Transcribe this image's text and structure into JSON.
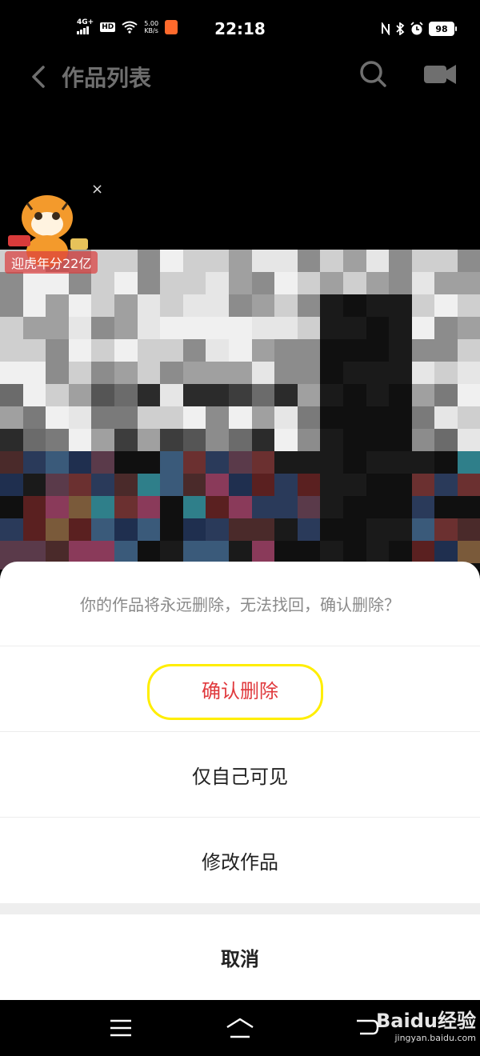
{
  "status_bar": {
    "network": "4G+",
    "hd": "HD",
    "speed_top": "5.00",
    "speed_bottom": "KB/s",
    "time": "22:18",
    "battery": "98"
  },
  "header": {
    "title": "作品列表",
    "icons": [
      "back-icon",
      "search-icon",
      "camera-icon"
    ]
  },
  "promo": {
    "banner_text": "迎虎年分22亿",
    "close_label": "×"
  },
  "sheet": {
    "message": "你的作品将永远删除，无法找回，确认删除？",
    "confirm_delete": "确认删除",
    "private_only": "仅自己可见",
    "edit_work": "修改作品",
    "cancel": "取消",
    "colors": {
      "danger": "#e0393d",
      "highlight": "#ffee00"
    }
  },
  "nav_bar": {
    "icons": [
      "menu-icon",
      "home-icon",
      "back-icon"
    ]
  },
  "watermark": {
    "logo": "Baidu经验",
    "url": "jingyan.baidu.com"
  }
}
